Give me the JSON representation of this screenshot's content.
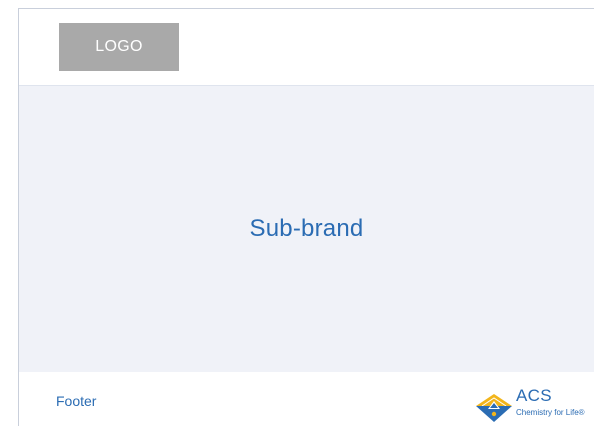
{
  "header": {
    "logo_label": "LOGO"
  },
  "hero": {
    "title": "Sub-brand"
  },
  "footer": {
    "label": "Footer",
    "brand": {
      "name": "ACS",
      "tagline": "Chemistry for Life®"
    }
  },
  "colors": {
    "accent": "#2b6cb3",
    "logo_placeholder": "#a9a9a9",
    "hero_background": "#f0f2f8",
    "frame_border": "#c9cfdb",
    "emblem_gold": "#f2b51b",
    "emblem_blue": "#2b6cb3"
  },
  "icons": {
    "brand_emblem": "acs-emblem-icon"
  }
}
